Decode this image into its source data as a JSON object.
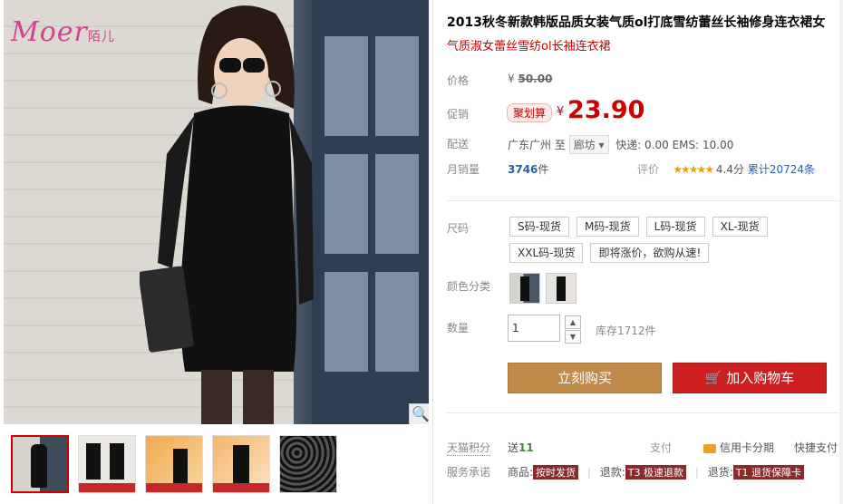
{
  "product": {
    "title": "2013秋冬新款韩版品质女装气质ol打底雪纺蕾丝长袖修身连衣裙女",
    "subtitle": "气质淑女蕾丝雪纺ol长袖连衣裙"
  },
  "brand": {
    "logo_text": "Moer",
    "logo_cn": "陌儿"
  },
  "price": {
    "label": "价格",
    "currency": "¥",
    "original": "50.00"
  },
  "promo": {
    "label": "促销",
    "tag": "聚划算",
    "currency": "¥",
    "price": "23.90"
  },
  "shipping": {
    "label": "配送",
    "origin": "广东广州",
    "to": "至",
    "destination": "廊坊",
    "fees": "快递: 0.00 EMS: 10.00"
  },
  "sales": {
    "label": "月销量",
    "count": "3746",
    "unit": "件",
    "rating_label": "评价",
    "stars": "★★★★★",
    "score": "4.4分",
    "total": "累计20724条"
  },
  "sku": {
    "size_label": "尺码",
    "sizes": [
      "S码-现货",
      "M码-现货",
      "L码-现货",
      "XL-现货",
      "XXL码-现货",
      "即将涨价，欲购从速!"
    ],
    "color_label": "颜色分类"
  },
  "quantity": {
    "label": "数量",
    "value": "1",
    "up": "▲",
    "down": "▼",
    "stock": "库存1712件"
  },
  "actions": {
    "buy_now": "立刻购买",
    "cart_icon": "🛒",
    "add_to_cart": "加入购物车"
  },
  "points": {
    "label": "天猫积分",
    "prefix": "送",
    "value": "11"
  },
  "payment": {
    "label": "支付",
    "credit": "信用卡分期",
    "express": "快捷支付"
  },
  "service": {
    "label": "服务承诺",
    "goods_label": "商品:",
    "goods_tag": "按时发货",
    "refund_label": "退款:",
    "refund_tag": "T3 极速退款",
    "return_label": "退货:",
    "return_tag": "T1 退货保障卡"
  },
  "icons": {
    "zoom": "🔍"
  }
}
